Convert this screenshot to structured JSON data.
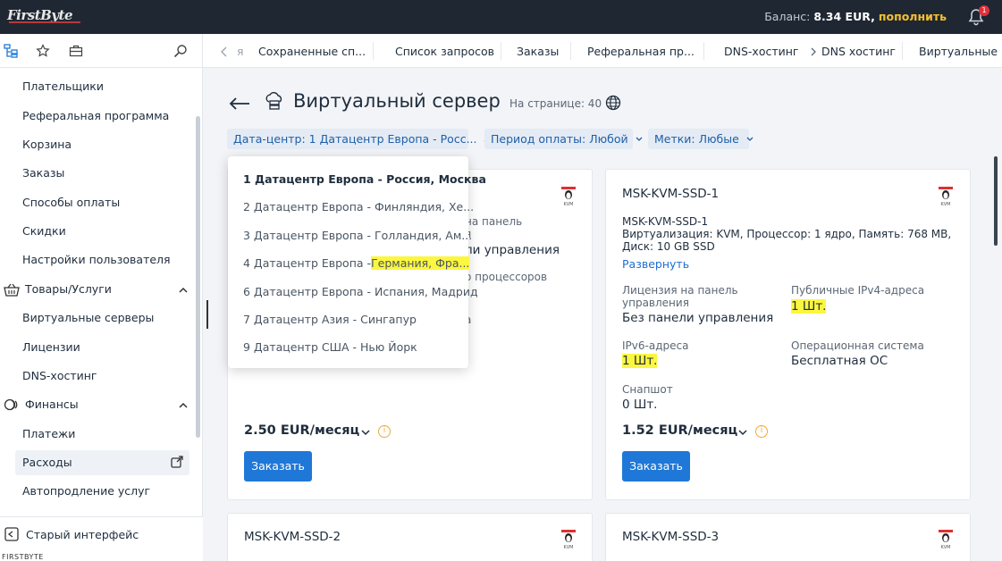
{
  "topbar": {
    "logo": "FirstByte",
    "balance_label": "Баланс:",
    "balance_value": "8.34 EUR,",
    "topup": "пополнить",
    "notifications": "1"
  },
  "sidebar": {
    "items": [
      "Плательщики",
      "Реферальная программа",
      "Корзина",
      "Заказы",
      "Способы оплаты",
      "Скидки",
      "Настройки пользователя"
    ],
    "group_goods": "Товары/Услуги",
    "goods_items": [
      "Виртуальные серверы",
      "Лицензии",
      "DNS-хостинг"
    ],
    "group_finance": "Финансы",
    "finance_items": [
      "Платежи",
      "Расходы",
      "Автопродление услуг"
    ],
    "old_interface": "Старый интерфейс",
    "footer_brand": "FIRSTBYTE"
  },
  "tabs": [
    "я",
    "Сохраненные сп...",
    "Список запросов",
    "Заказы",
    "Реферальная пр...",
    "DNS-хостинг",
    "DNS хостинг",
    "Виртуальные в"
  ],
  "page": {
    "title": "Виртуальный сервер",
    "per_page": "На странице: 40"
  },
  "filters": {
    "datacenter": "Дата-центр: 1 Датацентр Европа - Росс...",
    "period": "Период оплаты: Любой",
    "tags": "Метки: Любые"
  },
  "dropdown": {
    "options": [
      "1 Датацентр Европа - Россия, Москва",
      "2 Датацентр Европа - Финляндия, Хе...",
      "3 Датацентр Европа - Голландия, Ам...",
      "4 Датацентр Европа -",
      "Германия, Фра...",
      "6 Датацентр Европа - Испания, Мадрид",
      "7 Датацентр Азия - Сингапур",
      "9 Датацентр США - Нью Йорк"
    ]
  },
  "card1": {
    "peek_license_1": "на панель",
    "peek_license_2": "я",
    "peek_license_val": "ли управления",
    "peek_cpu": "о процессоров",
    "peek_misc": "а",
    "price": "2.50 EUR/месяц",
    "order": "Заказать"
  },
  "card2": {
    "title": "MSK-KVM-SSD-1",
    "desc_name": "MSK-KVM-SSD-1",
    "desc_line1": "Виртуализация: KVM, Процессор: 1 ядро, Память: 768 MB,",
    "desc_line2": "Диск: 10 GB SSD",
    "expand": "Развернуть",
    "license_label_1": "Лицензия на панель",
    "license_label_2": "управления",
    "license_value": "Без панели управления",
    "ipv4_label": "Публичные IPv4-адреса",
    "ipv4_value": "1 Шт.",
    "ipv6_label": "IPv6-адреса",
    "ipv6_value": "1 Шт.",
    "os_label": "Операционная система",
    "os_value": "Бесплатная ОС",
    "snapshot_label": "Снапшот",
    "snapshot_value": "0 Шт.",
    "price": "1.52 EUR/месяц",
    "order": "Заказать"
  },
  "card3": {
    "title": "MSK-KVM-SSD-2"
  },
  "card4": {
    "title": "MSK-KVM-SSD-3"
  },
  "colors": {
    "accent": "#1f78d7",
    "highlight": "#fbf63f",
    "topbar": "#1f2733",
    "topup": "#f6c02e"
  }
}
